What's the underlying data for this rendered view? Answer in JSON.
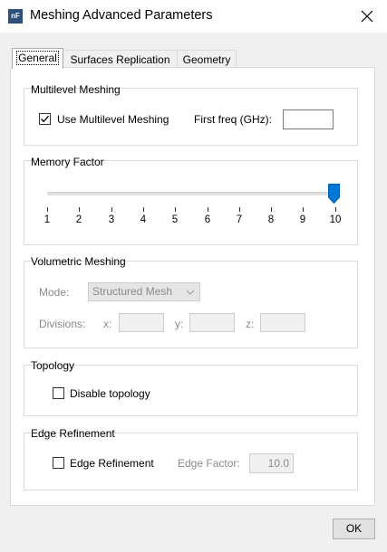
{
  "window": {
    "title": "Meshing Advanced Parameters",
    "app_icon_text": "nF"
  },
  "tabs": [
    {
      "label": "General",
      "active": true
    },
    {
      "label": "Surfaces Replication",
      "active": false
    },
    {
      "label": "Geometry",
      "active": false
    }
  ],
  "multilevel": {
    "title": "Multilevel Meshing",
    "use_label": "Use Multilevel Meshing",
    "use_checked": true,
    "freq_label": "First freq (GHz):",
    "freq_value": ""
  },
  "memory": {
    "title": "Memory Factor",
    "ticks": [
      "1",
      "2",
      "3",
      "4",
      "5",
      "6",
      "7",
      "8",
      "9",
      "10"
    ],
    "value": 10
  },
  "volumetric": {
    "title": "Volumetric Meshing",
    "mode_label": "Mode:",
    "mode_value": "Structured Mesh",
    "divisions_label": "Divisions:",
    "x_label": "x:",
    "y_label": "y:",
    "z_label": "z:",
    "x_value": "",
    "y_value": "",
    "z_value": "",
    "enabled": false
  },
  "topology": {
    "title": "Topology",
    "disable_label": "Disable topology",
    "disable_checked": false
  },
  "edge": {
    "title": "Edge Refinement",
    "refine_label": "Edge Refinement",
    "refine_checked": false,
    "factor_label": "Edge Factor:",
    "factor_value": "10.0"
  },
  "buttons": {
    "ok": "OK"
  },
  "colors": {
    "slider_thumb": "#0078d7",
    "disabled_text": "#8a8a8a"
  }
}
